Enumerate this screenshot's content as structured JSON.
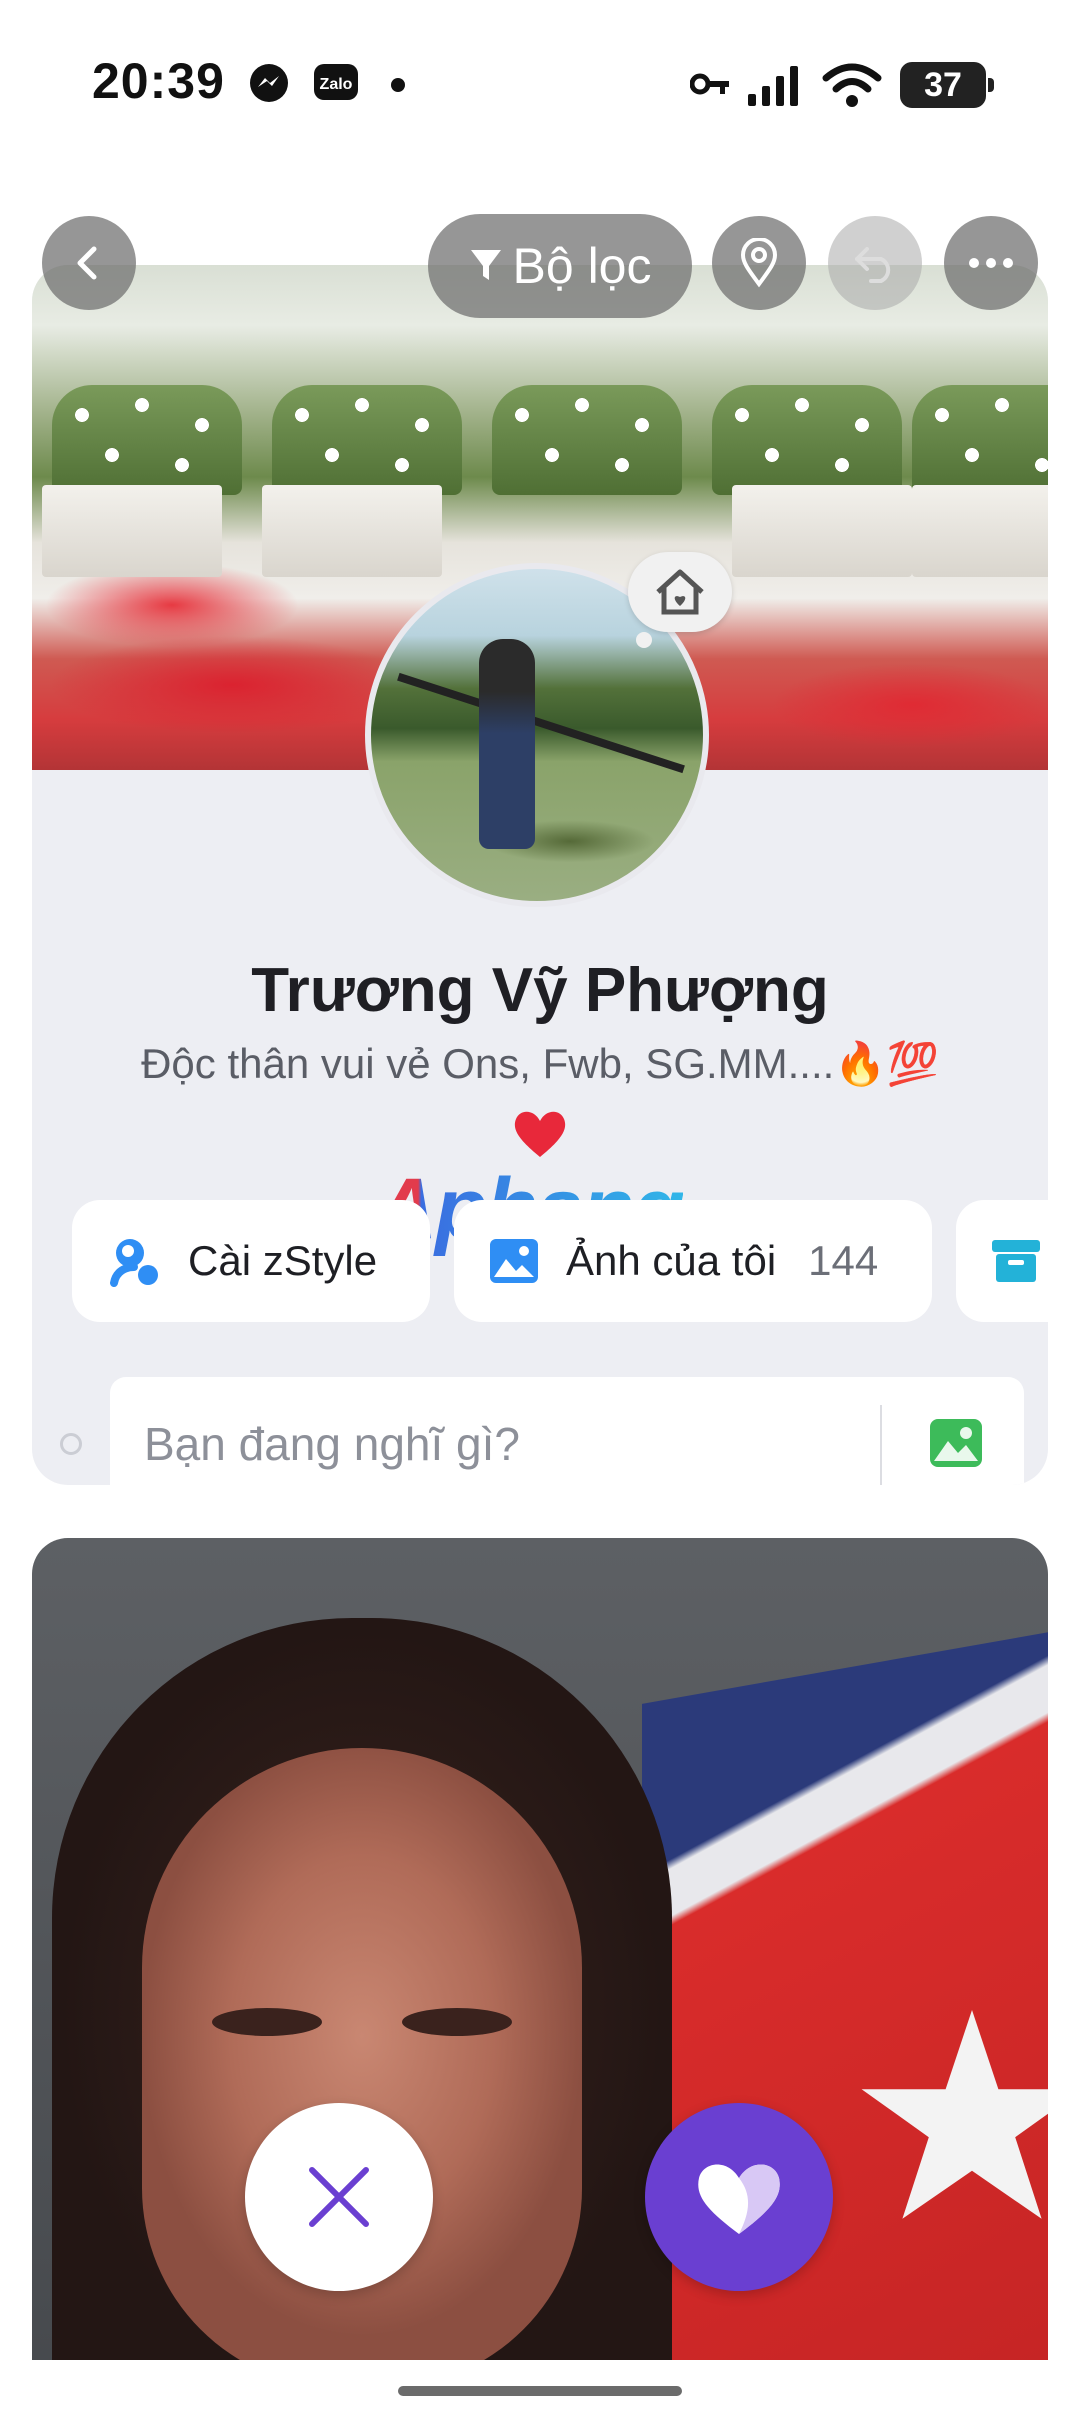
{
  "status_bar": {
    "time": "20:39",
    "battery": "37",
    "left_icons": [
      "messenger-icon",
      "zalo-icon",
      "dot"
    ],
    "right_icons": [
      "key-icon",
      "signal-icon",
      "wifi-icon",
      "battery-icon"
    ]
  },
  "top_controls": {
    "filter_label": "Bộ lọc",
    "icons": [
      "back-icon",
      "filter-icon",
      "location-icon",
      "undo-icon",
      "more-icon"
    ]
  },
  "profile": {
    "name": "Trương Vỹ Phượng",
    "bio": "Độc thân vui vẻ Ons, Fwb, SG.MM....🔥💯",
    "heart": "❤️"
  },
  "watermark": "Aphang",
  "actions": {
    "zstyle_label": "Cài zStyle",
    "photos_label": "Ảnh của tôi",
    "photos_count": "144"
  },
  "compose": {
    "placeholder": "Bạn đang nghĩ gì?"
  },
  "colors": {
    "accent_purple": "#6a3fd1",
    "card_bg": "#edeef3",
    "blue_icon": "#2f8ef4"
  }
}
